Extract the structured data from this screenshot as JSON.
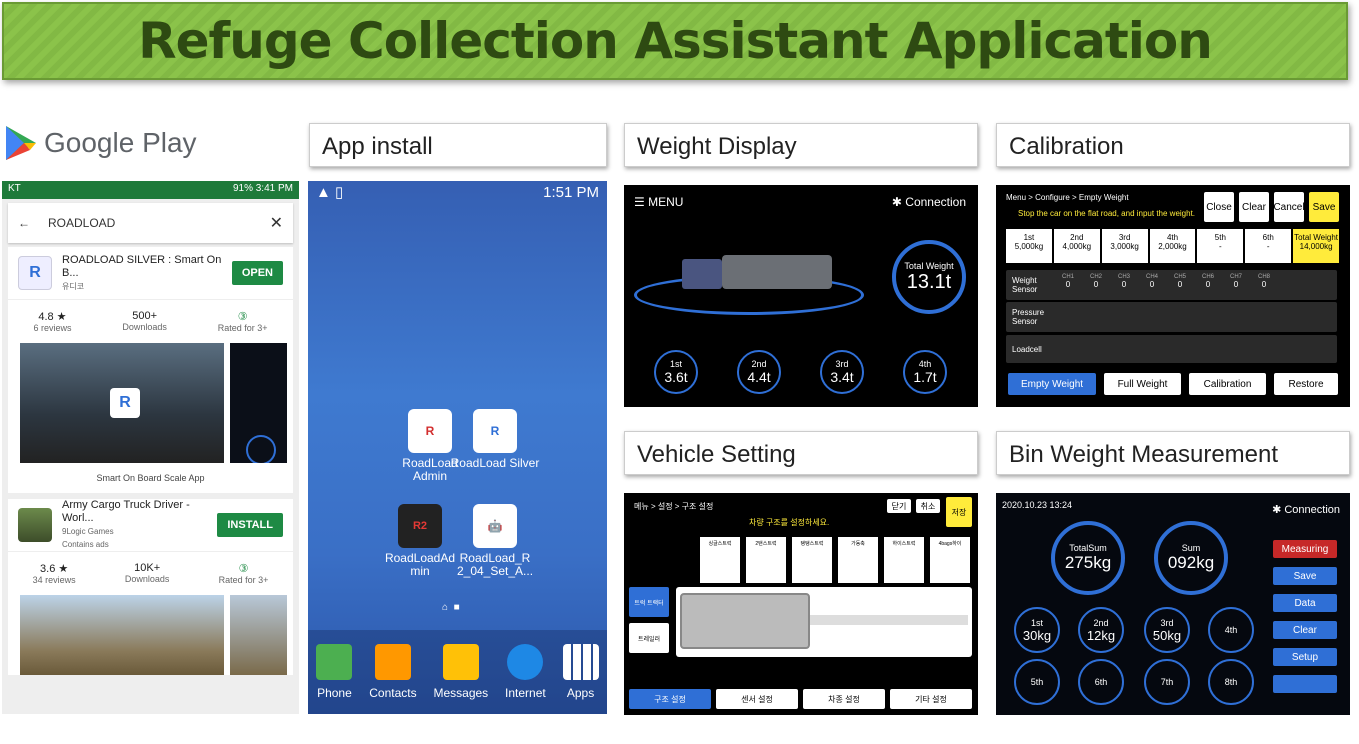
{
  "banner": {
    "title": "Refuge Collection Assistant Application"
  },
  "labels": {
    "google_play": "Google Play",
    "app_install": "App install",
    "weight_display": "Weight Display",
    "calibration": "Calibration",
    "vehicle_setting": "Vehicle Setting",
    "bin_weight": "Bin Weight Measurement"
  },
  "play": {
    "status_left": "KT",
    "status_right": "91% 3:41 PM",
    "search": "ROADLOAD",
    "app1": {
      "name": "ROADLOAD SILVER : Smart On B...",
      "dev": "유디코",
      "button": "OPEN",
      "rating": "4.8 ★",
      "reviews": "6 reviews",
      "downloads": "500+",
      "downloads_label": "Downloads",
      "rated": "Rated for 3+",
      "caption": "Smart On Board Scale App"
    },
    "app2": {
      "name": "Army Cargo Truck Driver - Worl...",
      "dev": "9Logic Games",
      "ads": "Contains ads",
      "button": "INSTALL",
      "rating": "3.6 ★",
      "reviews": "34 reviews",
      "downloads": "10K+",
      "downloads_label": "Downloads",
      "rated": "Rated for 3+"
    }
  },
  "android": {
    "time": "1:51 PM",
    "icons": [
      {
        "label": "RoadLoad Admin"
      },
      {
        "label": "RoadLoad Silver"
      },
      {
        "label": "RoadLoadAd min"
      },
      {
        "label": "RoadLoad_R 2_04_Set_A..."
      }
    ],
    "dock": [
      "Phone",
      "Contacts",
      "Messages",
      "Internet",
      "Apps"
    ]
  },
  "weight": {
    "menu": "MENU",
    "connection": "Connection",
    "total_label": "Total Weight",
    "total": "13.1t",
    "axles": [
      {
        "label": "1st",
        "value": "3.6t"
      },
      {
        "label": "2nd",
        "value": "4.4t"
      },
      {
        "label": "3rd",
        "value": "3.4t"
      },
      {
        "label": "4th",
        "value": "1.7t"
      }
    ]
  },
  "calib": {
    "crumb": "Menu > Configure  > Empty Weight",
    "hint": "Stop the car on the flat road, and input the weight.",
    "buttons": [
      "Close",
      "Clear",
      "Cancel",
      "Save"
    ],
    "cols": [
      {
        "h": "1st",
        "v": "5,000kg"
      },
      {
        "h": "2nd",
        "v": "4,000kg"
      },
      {
        "h": "3rd",
        "v": "3,000kg"
      },
      {
        "h": "4th",
        "v": "2,000kg"
      },
      {
        "h": "5th",
        "v": "-"
      },
      {
        "h": "6th",
        "v": "-"
      },
      {
        "h": "Total Weight",
        "v": "14,000kg"
      }
    ],
    "sensor_label": "Weight Sensor",
    "channels": [
      "CH1",
      "CH2",
      "CH3",
      "CH4",
      "CH5",
      "CH6",
      "CH7",
      "CH8"
    ],
    "ch_values": [
      "0",
      "0",
      "0",
      "0",
      "0",
      "0",
      "0",
      "0"
    ],
    "pressure": "Pressure Sensor",
    "loadcell": "Loadcell",
    "tabs": [
      "Empty Weight",
      "Full Weight",
      "Calibration",
      "Restore"
    ]
  },
  "vehicle": {
    "crumb": "메뉴 > 설정  > 구조 설정",
    "title": "차량 구조를 설정하세요.",
    "top_buttons": [
      "닫기",
      "취소"
    ],
    "save": "저장",
    "types": [
      "싱글스트럭",
      "2탠스트럭",
      "탱탱스트럭",
      "가동축",
      "하이스트럭",
      "4bags하이"
    ],
    "left_buttons": [
      "트럭 트랙터",
      "트레일러"
    ],
    "tabs": [
      "구조 설정",
      "센서 설정",
      "차종 설정",
      "기타 설정"
    ]
  },
  "bin": {
    "datetime": "2020.10.23  13:24",
    "connection": "Connection",
    "totalsum_label": "TotalSum",
    "totalsum": "275kg",
    "sum_label": "Sum",
    "sum": "092kg",
    "slots": [
      {
        "label": "1st",
        "value": "30kg"
      },
      {
        "label": "2nd",
        "value": "12kg"
      },
      {
        "label": "3rd",
        "value": "50kg"
      },
      {
        "label": "4th",
        "value": ""
      },
      {
        "label": "5th",
        "value": ""
      },
      {
        "label": "6th",
        "value": ""
      },
      {
        "label": "7th",
        "value": ""
      },
      {
        "label": "8th",
        "value": ""
      }
    ],
    "buttons": [
      "Measuring",
      "Save",
      "Data",
      "Clear",
      "Setup",
      ""
    ]
  },
  "colors": {
    "banner": "#8bc34a",
    "accent_blue": "#2f6fd6",
    "yellow": "#ffeb3b",
    "measuring": "#c62828",
    "play_green": "#1e8a44"
  }
}
